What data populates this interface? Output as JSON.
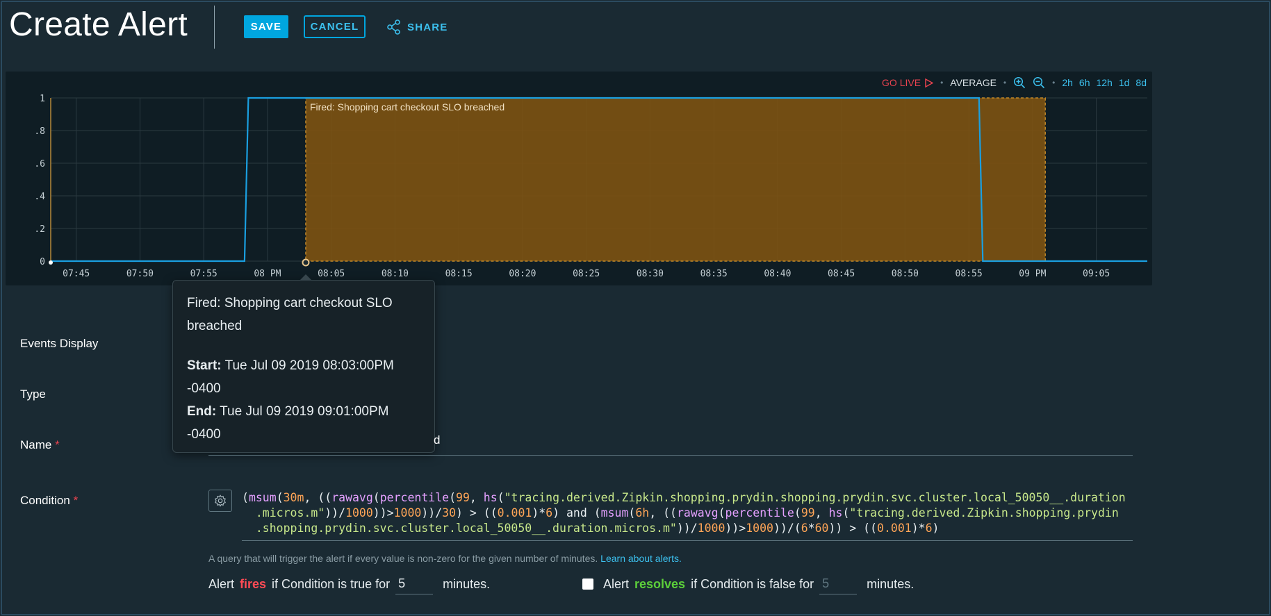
{
  "header": {
    "title": "Create Alert",
    "save_label": "SAVE",
    "cancel_label": "CANCEL",
    "share_label": "SHARE"
  },
  "chart_toolbar": {
    "go_live": "GO LIVE",
    "aggregation": "AVERAGE",
    "ranges": [
      "2h",
      "6h",
      "12h",
      "1d",
      "8d"
    ]
  },
  "chart_data": {
    "type": "line",
    "x_tick_labels": [
      "07:45",
      "07:50",
      "07:55",
      "08 PM",
      "08:05",
      "08:10",
      "08:15",
      "08:20",
      "08:25",
      "08:30",
      "08:35",
      "08:40",
      "08:45",
      "08:50",
      "08:55",
      "09 PM",
      "09:05"
    ],
    "y_tick_labels": [
      "0",
      ".2",
      ".4",
      ".6",
      ".8",
      "1"
    ],
    "ylim": [
      0,
      1
    ],
    "xlim_minutes": [
      -17,
      69
    ],
    "series": [
      {
        "points_minutes_from_8pm": [
          [
            -17,
            0
          ],
          [
            -1.8,
            0
          ],
          [
            -1.5,
            1
          ],
          [
            55.8,
            1
          ],
          [
            56.1,
            0
          ],
          [
            69,
            0
          ]
        ]
      }
    ],
    "event_band": {
      "start_minute": 3,
      "end_minute": 61,
      "label": "Fired: Shopping cart checkout SLO breached"
    },
    "colors": {
      "line": "#1a9fe0",
      "band": "#7d5312",
      "band_border": "#c2892a",
      "grid": "#2b3a41"
    }
  },
  "tooltip": {
    "title": "Fired: Shopping cart checkout SLO breached",
    "start_label": "Start:",
    "start_value": "Tue Jul 09 2019 08:03:00PM -0400",
    "end_label": "End:",
    "end_value": "Tue Jul 09 2019 09:01:00PM -0400"
  },
  "form": {
    "events_display_label": "Events Display",
    "type_label": "Type",
    "name_label": "Name",
    "name_value_visible": "d",
    "condition_label": "Condition",
    "hint_text": "A query that will trigger the alert if every value is non-zero for the given number of minutes.",
    "hint_link": "Learn about alerts.",
    "fires": {
      "prefix": "Alert",
      "word": "fires",
      "suffix": "if Condition is true for",
      "value": "5",
      "unit": "minutes."
    },
    "resolves": {
      "prefix": "Alert",
      "word": "resolves",
      "suffix": "if Condition is false for",
      "value": "5",
      "unit": "minutes."
    }
  }
}
